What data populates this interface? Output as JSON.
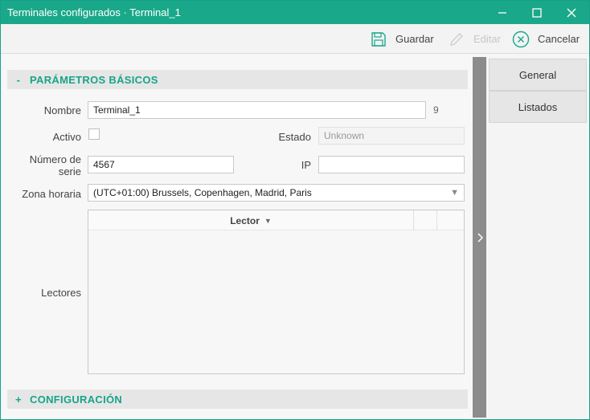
{
  "window": {
    "title": "Terminales configurados · Terminal_1"
  },
  "toolbar": {
    "save_label": "Guardar",
    "edit_label": "Editar",
    "cancel_label": "Cancelar"
  },
  "basic_section": {
    "sign": "-",
    "title": "PARÁMETROS BÁSICOS",
    "nombre_label": "Nombre",
    "nombre_value": "Terminal_1",
    "nombre_count": "9",
    "activo_label": "Activo",
    "estado_label": "Estado",
    "estado_value": "Unknown",
    "numero_serie_label_1": "Número de",
    "numero_serie_label_2": "serie",
    "numero_serie_value": "4567",
    "ip_label": "IP",
    "ip_value": "",
    "zona_label": "Zona horaria",
    "zona_value": "(UTC+01:00) Brussels, Copenhagen, Madrid, Paris",
    "lectores_label": "Lectores",
    "grid_header": "Lector"
  },
  "config_section": {
    "sign": "+",
    "title": "CONFIGURACIÓN"
  },
  "right_tabs": [
    {
      "label": "General"
    },
    {
      "label": "Listados"
    }
  ],
  "colors": {
    "accent": "#1aa88a"
  }
}
